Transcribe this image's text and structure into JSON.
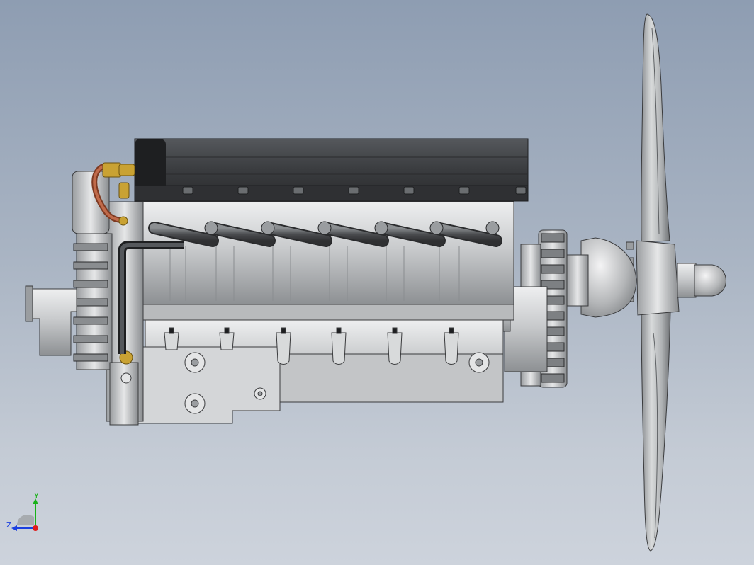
{
  "viewport": {
    "background_top": "#8e9db2",
    "background_bottom": "#cdd3dc"
  },
  "model": {
    "assembly": "v12-aircraft-engine-with-propeller",
    "colors": {
      "metal_light": "#d4d6d8",
      "metal_mid": "#a9acaf",
      "metal_dark": "#6d7074",
      "valve_cover": "#3b3d40",
      "valve_cover_dark": "#1e1f21",
      "brass": "#c9a233",
      "copper": "#b0573a",
      "pipe": "#4a4c4f",
      "outline": "#2a2b2d"
    }
  },
  "triad": {
    "x_label": "Y",
    "z_label": "Z",
    "y_color": "#19b219",
    "z_color": "#1b3fe0",
    "origin_color": "#e01b1b"
  }
}
